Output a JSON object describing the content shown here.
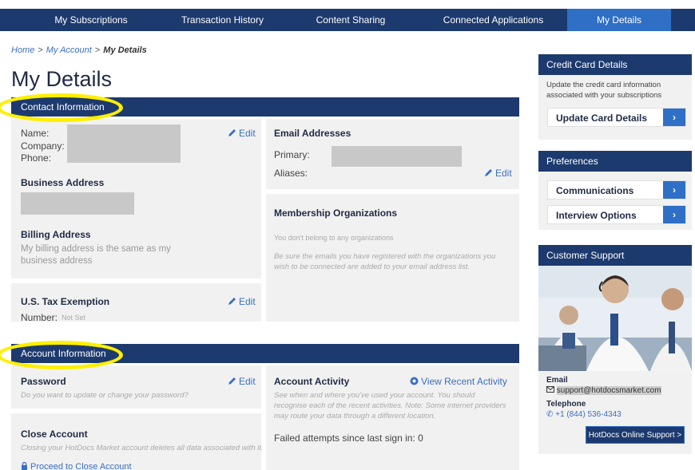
{
  "nav": {
    "tabs": [
      {
        "label": "My Subscriptions"
      },
      {
        "label": "Transaction History"
      },
      {
        "label": "Content Sharing"
      },
      {
        "label": "Connected Applications"
      },
      {
        "label": "My Details"
      }
    ],
    "active_index": 4
  },
  "breadcrumb": {
    "home": "Home",
    "sep1": ">",
    "account": "My Account",
    "sep2": ">",
    "current": "My Details"
  },
  "page_title": "My Details",
  "contact": {
    "header": "Contact Information",
    "name_label": "Name:",
    "company_label": "Company:",
    "phone_label": "Phone:",
    "edit": "Edit",
    "business_address": "Business Address",
    "billing_address": "Billing Address",
    "billing_text": "My billing address is the same as my business address",
    "email_heading": "Email Addresses",
    "primary_label": "Primary:",
    "aliases_label": "Aliases:",
    "membership_heading": "Membership Organizations",
    "membership_none": "You don't belong to any organizations",
    "membership_note": "Be sure the emails you have registered with the organizations you wish to be connected are added to your email address list.",
    "tax_heading": "U.S. Tax Exemption",
    "tax_number_label": "Number:",
    "tax_number_value": "Not Set"
  },
  "account": {
    "header": "Account Information",
    "password_heading": "Password",
    "password_note": "Do you want to update or change your password?",
    "activity_heading": "Account Activity",
    "view_activity": "View Recent Activity",
    "activity_note": "See when and where you've used your account. You should recognise each of the recent activities. Note: Some internet providers may route your data through a different location.",
    "failed_attempts": "Failed attempts since last sign in: 0",
    "close_heading": "Close Account",
    "close_note": "Closing your HotDocs Market account deletes all data associated with it.",
    "close_link": "Proceed to Close Account"
  },
  "sidebar": {
    "credit": {
      "header": "Credit Card Details",
      "text": "Update the credit card information associated with your subscriptions",
      "button": "Update Card Details"
    },
    "preferences": {
      "header": "Preferences",
      "items": [
        {
          "label": "Communications"
        },
        {
          "label": "Interview Options"
        }
      ]
    },
    "support": {
      "header": "Customer Support",
      "email_label": "Email",
      "email": "support@hotdocsmarket.com",
      "phone_label": "Telephone",
      "phone": "+1 (844) 536-4343",
      "button": "HotDocs Online Support >"
    }
  },
  "colors": {
    "nav": "#1d3a6e",
    "accent": "#2f6fc6",
    "highlight": "#ffef00",
    "panel": "#f1f1f1"
  }
}
